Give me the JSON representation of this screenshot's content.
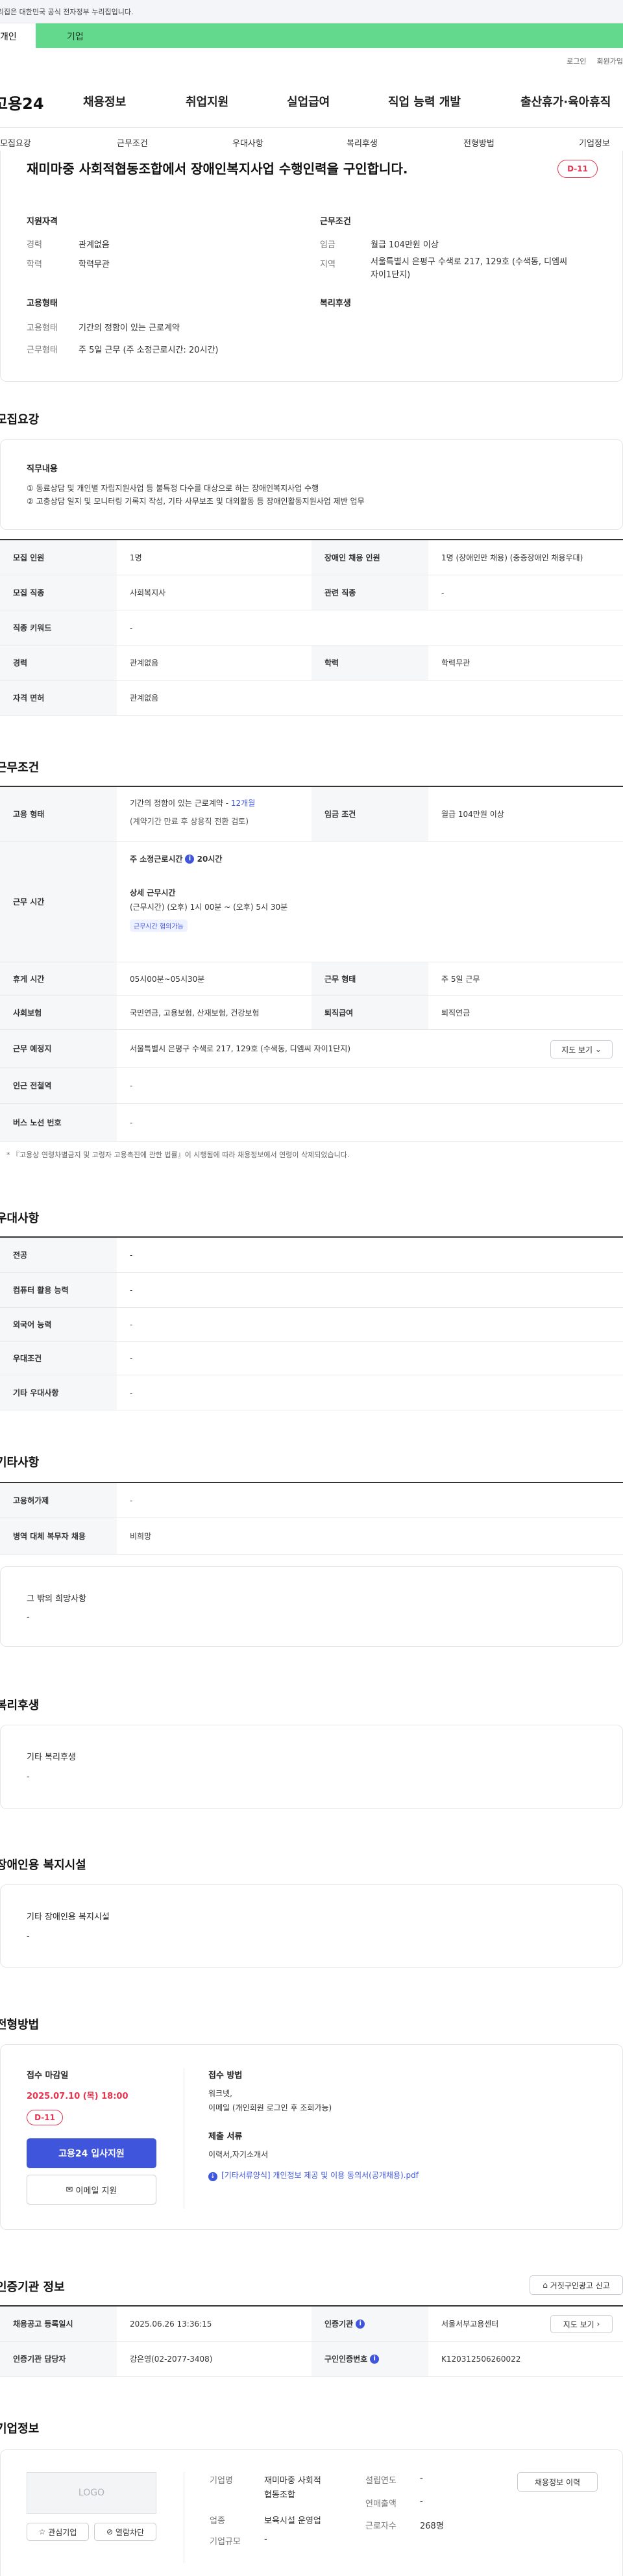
{
  "gov_notice": "이 누리집은 대한민국 공식 전자정부 누리집입니다.",
  "top_tabs": [
    "개인",
    "기업"
  ],
  "util_links": [
    "로그인",
    "회원가입"
  ],
  "brand": "고용24",
  "gnb": [
    "채용정보",
    "취업지원",
    "실업급여",
    "직업 능력 개발",
    "출산휴가·육아휴직"
  ],
  "subnav": [
    "모집요강",
    "근무조건",
    "우대사항",
    "복리후생",
    "전형방법",
    "기업정보"
  ],
  "summary": {
    "title": "재미마중 사회적협동조합에서 장애인복지사업 수행인력을 구인합니다.",
    "dday": "D-11",
    "qual_title": "지원자격",
    "qual": [
      {
        "k": "경력",
        "v": "관계없음"
      },
      {
        "k": "학력",
        "v": "학력무관"
      }
    ],
    "cond_title": "근무조건",
    "cond": [
      {
        "k": "임금",
        "v": "월급 104만원 이상"
      },
      {
        "k": "지역",
        "v": "서울특별시 은평구 수색로 217, 129호 (수색동, 디엠씨",
        "v2": "자이1단지)"
      }
    ],
    "emp_title": "고용형태",
    "emp": [
      {
        "k": "고용형태",
        "v": "기간의 정함이 있는 근로계약"
      },
      {
        "k": "근무형태",
        "v": "주 5일 근무 (주 소정근로시간: 20시간)"
      }
    ],
    "welfare_title": "복리후생"
  },
  "recruit": {
    "section_title": "모집요강",
    "duty_title": "직무내용",
    "duty_lines": [
      "① 동료상담 및 개인별 자립지원사업 등 불특정 다수를 대상으로 하는 장애인복지사업 수행",
      "② 고충상담 일지 및 모니터링 기록지 작성, 기타 사무보조 및 대외활동 등 장애인활동지원사업 제반 업무"
    ],
    "rows": [
      {
        "k1": "모집 인원",
        "v1": "1명",
        "k2": "장애인 채용 인원",
        "v2": "1명 (장애인만 채용) (중증장애인 채용우대)"
      },
      {
        "k1": "모집 직종",
        "v1": "사회복지사",
        "k2": "관련 직종",
        "v2": "-"
      },
      {
        "k1": "직종 키워드",
        "v1": "-"
      },
      {
        "k1": "경력",
        "v1": "관계없음",
        "k2": "학력",
        "v2": "학력무관"
      },
      {
        "k1": "자격 면허",
        "v1": "관계없음"
      }
    ]
  },
  "work": {
    "section_title": "근무조건",
    "emp_k": "고용 형태",
    "emp_v1": "기간의 정함이 있는 근로계약 - ",
    "emp_v1_hl": "12개월",
    "emp_v2": "(계약기간 만료 후 상용직 전환 검토)",
    "wage_k": "임금 조건",
    "wage_v": "월급 104만원 이상",
    "hours_k": "근무 시간",
    "hours_v1": "주 소정근로시간",
    "hours_v1b": "20시간",
    "hours_detail_title": "상세 근무시간",
    "hours_detail": "(근무시간) (오후) 1시 00분 ~ (오후) 5시 30분",
    "hours_pill": "근무시간 협의가능",
    "rest_k": "휴게 시간",
    "rest_v": "05시00분~05시30분",
    "type_k": "근무 형태",
    "type_v": "주 5일 근무",
    "ins_k": "사회보험",
    "ins_v": "국민연금, 고용보험, 산재보험, 건강보험",
    "sev_k": "퇴직급여",
    "sev_v": "퇴직연금",
    "place_k": "근무 예정지",
    "place_v": "서울특별시 은평구 수색로 217, 129호 (수색동, 디엠씨 자이1단지)",
    "map_btn": "지도 보기",
    "subway_k": "인근 전철역",
    "subway_v": "-",
    "bus_k": "버스 노선 번호",
    "bus_v": "-",
    "note": "* 『고용상 연령차별금지 및 고령자 고용촉진에 관한 법률』이 시행됨에 따라 채용정보에서 연령이 삭제되었습니다."
  },
  "pref": {
    "section_title": "우대사항",
    "rows": [
      {
        "k": "전공",
        "v": "-"
      },
      {
        "k": "컴퓨터 활용 능력",
        "v": "-"
      },
      {
        "k": "외국어 능력",
        "v": "-"
      },
      {
        "k": "우대조건",
        "v": "-"
      },
      {
        "k": "기타 우대사항",
        "v": "-"
      }
    ]
  },
  "etc": {
    "section_title": "기타사항",
    "rows": [
      {
        "k": "고용허가제",
        "v": "-"
      },
      {
        "k": "병역 대체 복무자 채용",
        "v": "비희망"
      }
    ],
    "other_title": "그 밖의 희망사항",
    "other_v": "-"
  },
  "welfare": {
    "section_title": "복리후생",
    "box_title": "기타 복리후생",
    "box_v": "-"
  },
  "facility": {
    "section_title": "장애인용 복지시설",
    "box_title": "기타 장애인용 복지시설",
    "box_v": "-"
  },
  "process": {
    "section_title": "전형방법",
    "deadline_label": "접수 마감일",
    "deadline": "2025.07.10 (목) 18:00",
    "dday": "D-11",
    "apply_btn": "고용24 입사지원",
    "email_btn": "이메일 지원",
    "method_title": "접수 방법",
    "method_v1": "워크넷,",
    "method_v2": "이메일 (개인회원 로그인 후 조회가능)",
    "docs_title": "제출 서류",
    "docs_v": "이력서,자기소개서",
    "docs_file": "[기타서류양식] 개인정보 제공 및 이용 동의서(공개채용).pdf"
  },
  "cert": {
    "section_title": "인증기관 정보",
    "report_btn": "거짓구인광고 신고",
    "r1": {
      "k1": "채용공고 등록일시",
      "v1": "2025.06.26 13:36:15",
      "k2": "인증기관",
      "v2": "서울서부고용센터",
      "btn": "지도 보기"
    },
    "r2": {
      "k1": "인증기관 담당자",
      "v1": "강은영(02-2077-3408)",
      "k2": "구인인증번호",
      "v2": "K120312506260022"
    }
  },
  "company": {
    "section_title": "기업정보",
    "logo": "LOGO",
    "fav_btn": "관심기업",
    "block_btn": "열람차단",
    "name_k": "기업명",
    "name_v1": "재미마중 사회적",
    "name_v2": "협동조합",
    "year_k": "설립연도",
    "year_v": "-",
    "ind_k": "업종",
    "ind_v": "보육시설 운영업",
    "sales_k": "연매출액",
    "sales_v": "-",
    "size_k": "기업규모",
    "size_v": "-",
    "emp_k": "근로자수",
    "emp_v": "268명",
    "history_btn": "채용정보 이력"
  }
}
